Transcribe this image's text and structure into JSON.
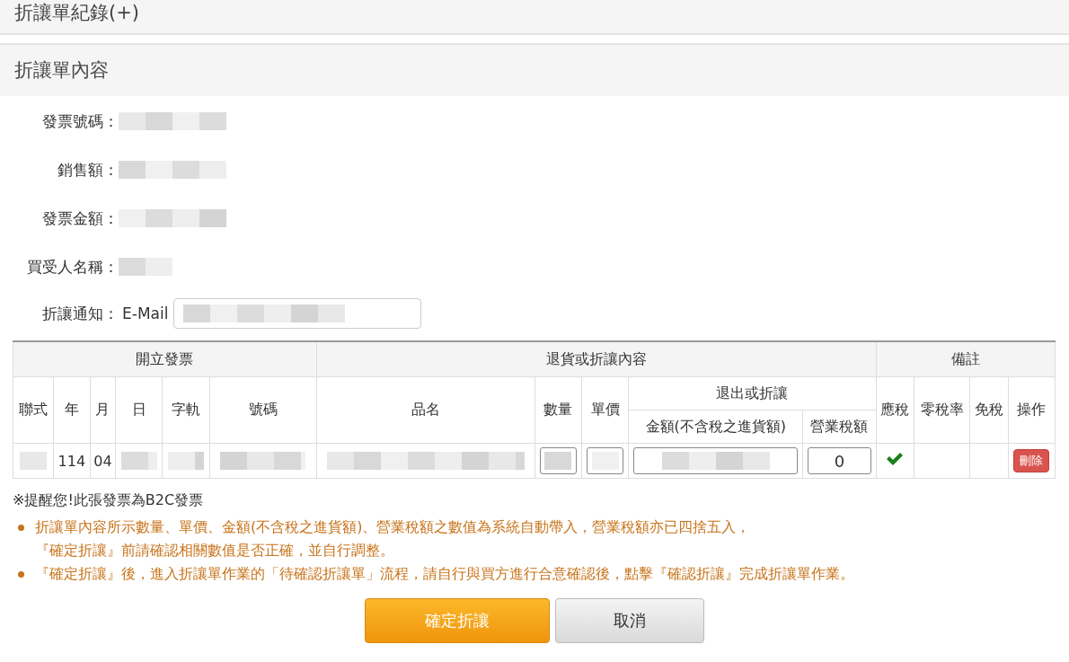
{
  "record_section": {
    "title": "折讓單紀錄(+)"
  },
  "content_section": {
    "title": "折讓單內容"
  },
  "form": [
    {
      "label": "發票號碼：",
      "kind": "blurred"
    },
    {
      "label": "銷售額：",
      "kind": "blurred"
    },
    {
      "label": "發票金額：",
      "kind": "blurred"
    },
    {
      "label": "買受人名稱：",
      "kind": "blurred"
    },
    {
      "label": "折讓通知：",
      "kind": "email",
      "prefix": "E-Mail"
    }
  ],
  "table": {
    "groups": [
      "開立發票",
      "退貨或折讓內容",
      "備註"
    ],
    "columns": [
      "聯式",
      "年",
      "月",
      "日",
      "字軌",
      "號碼",
      "品名",
      "數量",
      "單價",
      "退出或折讓",
      "應稅",
      "零稅率",
      "免稅",
      "操作"
    ],
    "subcolumns": [
      "金額(不含稅之進貨額)",
      "營業稅額"
    ],
    "row": [
      {
        "kind": "blurred"
      },
      {
        "kind": "text",
        "text": "114"
      },
      {
        "kind": "text",
        "text": "04"
      },
      {
        "kind": "blurred"
      },
      {
        "kind": "blurred"
      },
      {
        "kind": "blurred"
      },
      {
        "kind": "blurred"
      },
      {
        "kind": "input"
      },
      {
        "kind": "input"
      },
      {
        "kind": "input"
      },
      {
        "kind": "input",
        "value": "0"
      },
      {
        "kind": "tax",
        "checked": true
      },
      {
        "kind": "tax",
        "checked": false
      },
      {
        "kind": "tax",
        "checked": false
      },
      {
        "kind": "button",
        "text": "刪除"
      }
    ]
  },
  "notice": "※提醒您!此張發票為B2C發票",
  "notes": [
    "折讓單內容所示數量、單價、金額(不含稅之進貨額)、營業稅額之數值為系統自動帶入，營業稅額亦已四捨五入，『確定折讓』前請確認相關數值是否正確，並自行調整。",
    "『確定折讓』後，進入折讓單作業的「待確認折讓單」流程，請自行與買方進行合意確認後，點擊『確認折讓』完成折讓單作業。"
  ],
  "buttons": [
    {
      "label": "確定折讓",
      "kind": "primary"
    },
    {
      "label": "取消",
      "kind": "default"
    }
  ]
}
